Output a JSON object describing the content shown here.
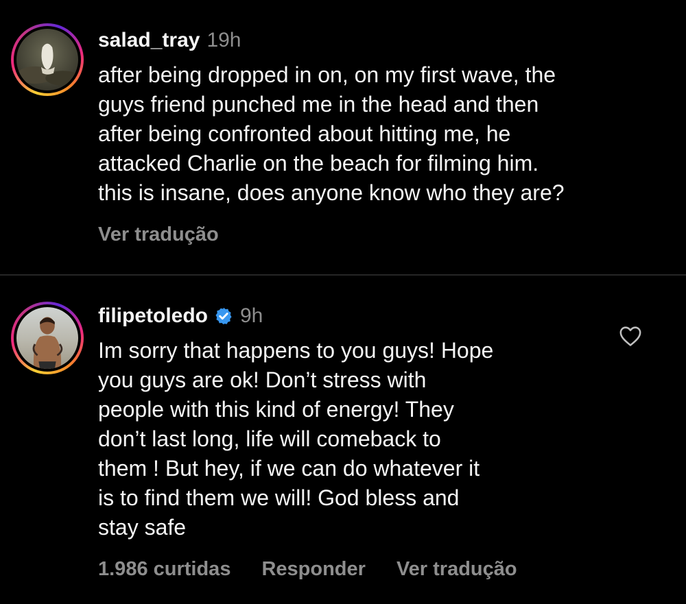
{
  "colors": {
    "background": "#000000",
    "text": "#f5f5f5",
    "secondary": "#8e8e8e",
    "verified": "#3897f0",
    "divider": "#262626"
  },
  "comments": [
    {
      "username": "salad_tray",
      "time": "19h",
      "verified": false,
      "text": "after being dropped in on, on my first wave, the\nguys friend punched me in the head and then\nafter being confronted about hitting me, he\nattacked Charlie on the beach for filming him.\nthis is insane, does anyone know who they are?",
      "see_translation": "Ver tradução"
    },
    {
      "username": "filipetoledo",
      "time": "9h",
      "verified": true,
      "verified_icon": "verified-badge-icon",
      "text": "Im sorry that happens to you guys! Hope\nyou guys are ok! Don’t stress with\npeople with this kind of energy! They\ndon’t last long, life will comeback to\nthem ! But hey, if we can do whatever it\nis to find them we will! God bless  and\nstay safe",
      "likes": "1.986 curtidas",
      "reply": "Responder",
      "see_translation": "Ver tradução",
      "like_icon": "heart-outline-icon"
    }
  ]
}
